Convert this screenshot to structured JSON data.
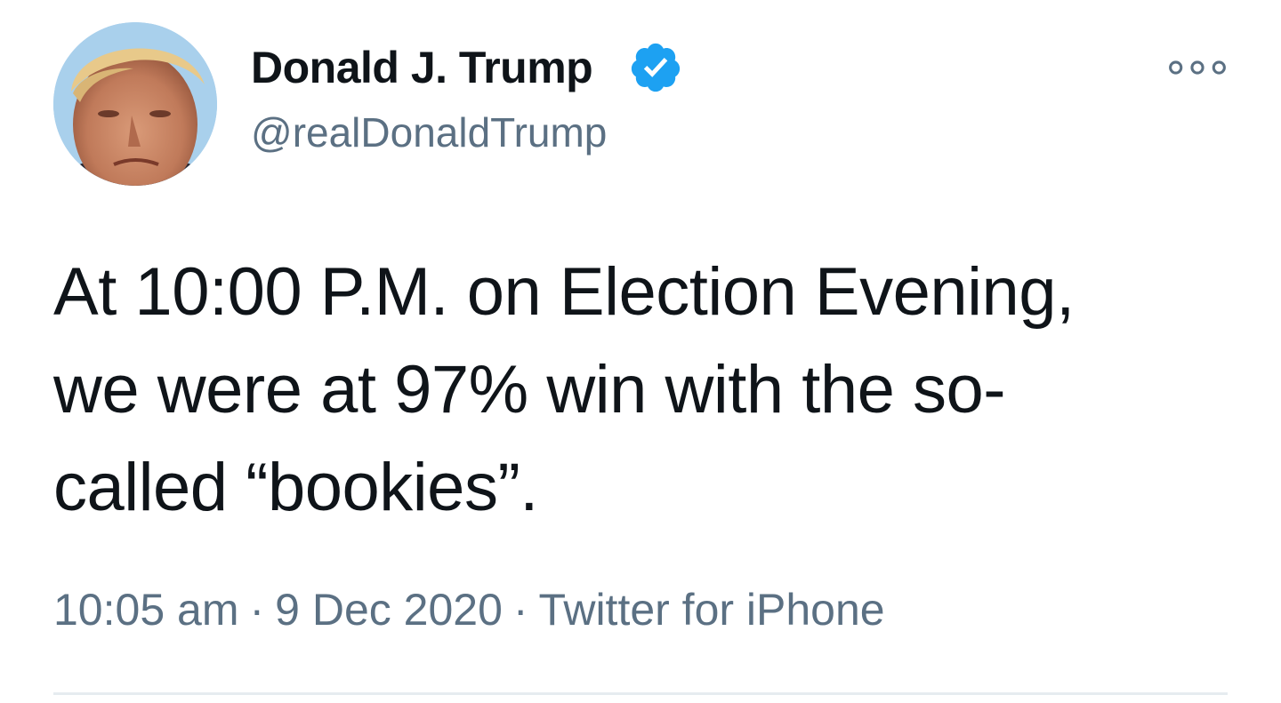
{
  "author": {
    "display_name": "Donald J. Trump",
    "handle": "@realDonaldTrump",
    "verified_icon": "verified-badge-icon",
    "avatar_icon": "profile-photo"
  },
  "tweet": {
    "text": "At 10:00 P.M. on Election Evening,\nwe were at 97% win with the so-\ncalled “bookies”."
  },
  "meta": {
    "time": "10:05 am",
    "separator": "·",
    "date": "9 Dec 2020",
    "source": "Twitter for iPhone"
  },
  "more_icon": "more-options-icon",
  "colors": {
    "text_primary": "#0f1419",
    "text_secondary": "#5b7083",
    "verified_blue": "#1da1f2",
    "divider": "#e6ecf0"
  }
}
